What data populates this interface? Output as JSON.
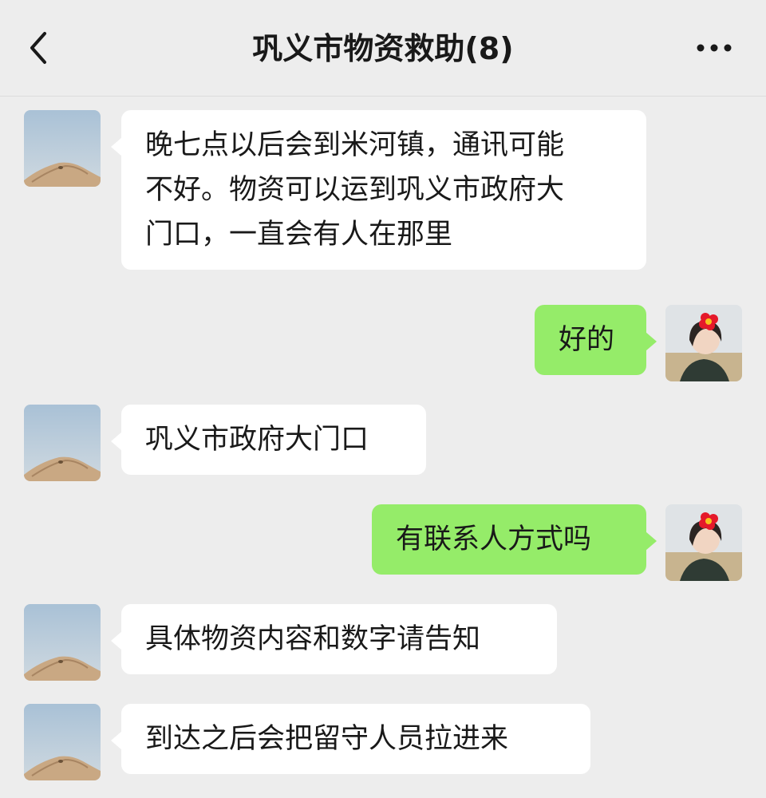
{
  "header": {
    "title": "巩义市物资救助(8)",
    "back_icon": "chevron-left-icon",
    "more_icon": "ellipsis-icon"
  },
  "colors": {
    "background": "#ededed",
    "incoming_bubble": "#ffffff",
    "outgoing_bubble": "#95ec69",
    "text": "#191919"
  },
  "messages": [
    {
      "side": "incoming",
      "avatar": "sand-mound-avatar",
      "lines": [
        "晚七点以后会到米河镇，通讯可能",
        "不好。物资可以运到巩义市政府大",
        "门口，一直会有人在那里"
      ]
    },
    {
      "side": "outgoing",
      "avatar": "user-photo-avatar",
      "lines": [
        "好的"
      ]
    },
    {
      "side": "incoming",
      "avatar": "sand-mound-avatar",
      "lines": [
        "巩义市政府大门口"
      ]
    },
    {
      "side": "outgoing",
      "avatar": "user-photo-avatar",
      "lines": [
        "有联系人方式吗"
      ]
    },
    {
      "side": "incoming",
      "avatar": "sand-mound-avatar",
      "lines": [
        "具体物资内容和数字请告知"
      ]
    },
    {
      "side": "incoming",
      "avatar": "sand-mound-avatar",
      "lines": [
        "到达之后会把留守人员拉进来"
      ]
    }
  ]
}
